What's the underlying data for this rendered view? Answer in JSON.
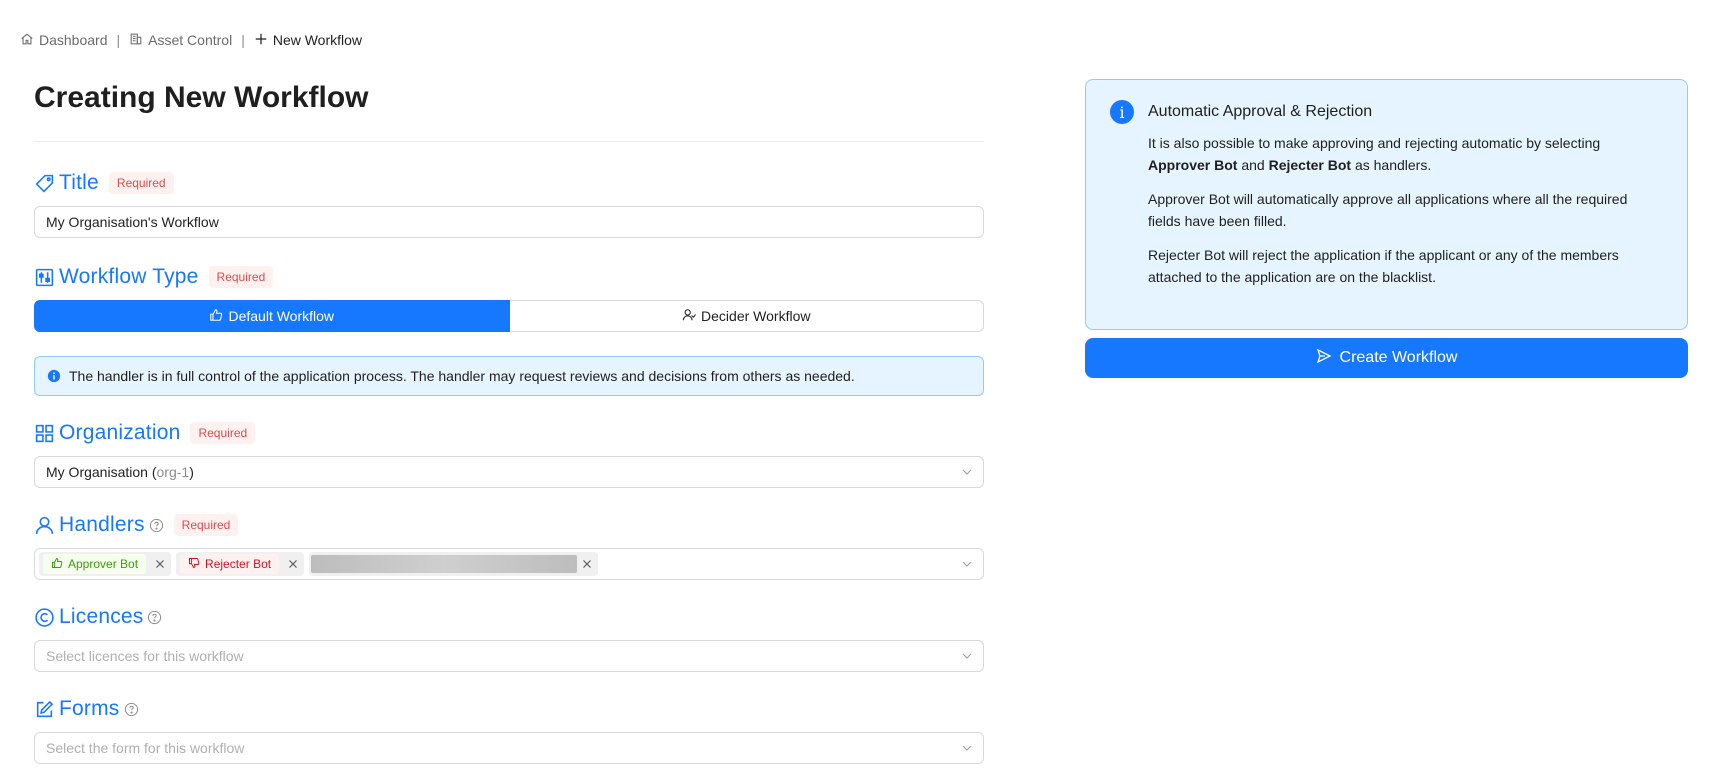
{
  "breadcrumb": {
    "items": [
      {
        "label": "Dashboard",
        "icon": "home-icon"
      },
      {
        "label": "Asset Control",
        "icon": "building-icon"
      },
      {
        "label": "New Workflow",
        "icon": "plus-icon"
      }
    ],
    "separator": "|"
  },
  "page": {
    "title": "Creating New Workflow"
  },
  "required_label": "Required",
  "title_section": {
    "label": "Title",
    "icon": "tag-icon",
    "value": "My Organisation's Workflow"
  },
  "workflow_type": {
    "label": "Workflow Type",
    "icon": "sliders-icon",
    "options": [
      {
        "label": "Default Workflow",
        "icon": "thumbs-up-icon",
        "selected": true
      },
      {
        "label": "Decider Workflow",
        "icon": "user-switch-icon",
        "selected": false
      }
    ],
    "info": "The handler is in full control of the application process. The handler may request reviews and decisions from others as needed."
  },
  "organization": {
    "label": "Organization",
    "icon": "grid-icon",
    "value_name": "My Organisation",
    "value_open": " (",
    "value_id": "org-1",
    "value_close": ")"
  },
  "handlers": {
    "label": "Handlers",
    "icon": "user-icon",
    "tags": [
      {
        "label": "Approver Bot",
        "icon": "thumbs-up-icon",
        "color": "#389e0d"
      },
      {
        "label": "Rejecter Bot",
        "icon": "thumbs-down-icon",
        "color": "#cf1322"
      }
    ]
  },
  "licences": {
    "label": "Licences",
    "icon": "copyright-icon",
    "placeholder": "Select licences for this workflow"
  },
  "forms": {
    "label": "Forms",
    "icon": "edit-icon",
    "placeholder": "Select the form for this workflow"
  },
  "side_info": {
    "title": "Automatic Approval & Rejection",
    "p1_a": "It is also possible to make approving and rejecting automatic by selecting ",
    "p1_b": "Approver Bot",
    "p1_c": " and ",
    "p1_d": "Rejecter Bot",
    "p1_e": " as handlers.",
    "p2": "Approver Bot will automatically approve all applications where all the required fields have been filled.",
    "p3": "Rejecter Bot will reject the application if the applicant or any of the members attached to the application are on the blacklist."
  },
  "create_button": {
    "label": "Create Workflow",
    "icon": "send-icon"
  },
  "colors": {
    "accent": "#1677ff",
    "required": "#e04a4a",
    "info_bg": "#e6f4ff"
  }
}
